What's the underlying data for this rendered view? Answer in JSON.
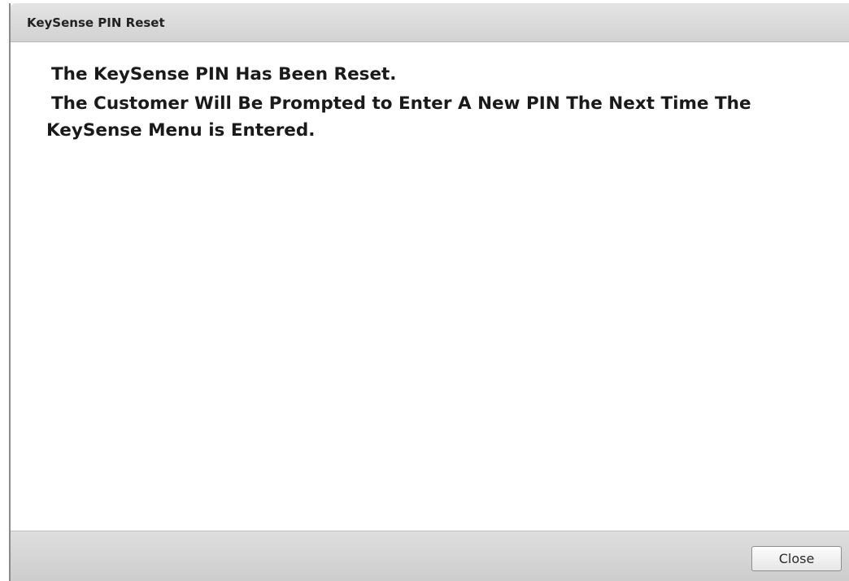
{
  "dialog": {
    "title": "KeySense PIN Reset",
    "message_line1": "The KeySense PIN Has Been Reset.",
    "message_line2": "The Customer Will Be Prompted to Enter A New PIN The Next Time The",
    "message_line3": "KeySense Menu is Entered.",
    "close_label": "Close"
  }
}
